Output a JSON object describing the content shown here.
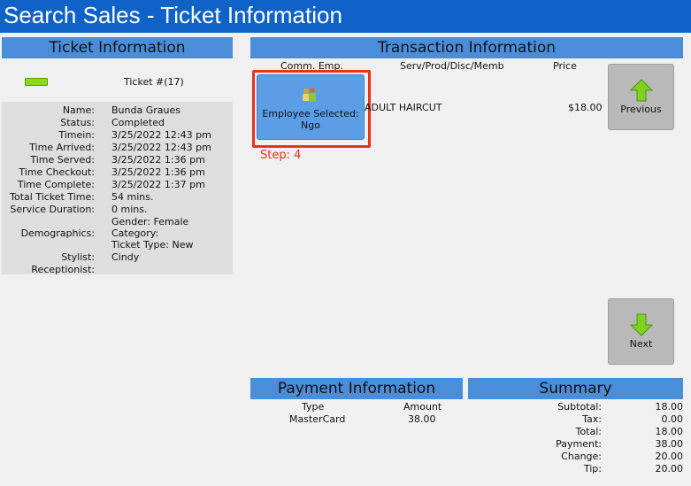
{
  "window": {
    "title": "Search Sales - Ticket Information"
  },
  "ticket_panel": {
    "header": "Ticket Information",
    "ticket_number": "Ticket #(17)",
    "fields": [
      {
        "label": "Name:",
        "value": "Bunda Graues"
      },
      {
        "label": "Status:",
        "value": "Completed"
      },
      {
        "label": "Timein:",
        "value": "3/25/2022 12:43 pm"
      },
      {
        "label": "Time Arrived:",
        "value": "3/25/2022 12:43 pm"
      },
      {
        "label": "Time Served:",
        "value": "3/25/2022 1:36 pm"
      },
      {
        "label": "Time Checkout:",
        "value": "3/25/2022 1:36 pm"
      },
      {
        "label": "Time Complete:",
        "value": "3/25/2022 1:37 pm"
      },
      {
        "label": "Total Ticket Time:",
        "value": "54 mins."
      },
      {
        "label": "Service Duration:",
        "value": "0 mins."
      }
    ],
    "demographics": {
      "label": "Demographics:",
      "lines": [
        "Gender: Female",
        "Category:",
        "Ticket Type: New"
      ]
    },
    "stylist": {
      "label": "Stylist:",
      "value": "Cindy"
    },
    "receptionist": {
      "label": "Receptionist:",
      "value": ""
    }
  },
  "transaction_panel": {
    "header": "Transaction Information",
    "columns": [
      "Comm. Emp.",
      "Serv/Prod/Disc/Memb",
      "Price"
    ],
    "rows": [
      {
        "service": "ADULT HAIRCUT",
        "price": "$18.00"
      }
    ],
    "employee_button": {
      "line1": "Employee Selected:",
      "line2": "Ngo"
    },
    "step_label": "Step: 4",
    "previous_label": "Previous",
    "next_label": "Next"
  },
  "payment_panel": {
    "header": "Payment Information",
    "columns": [
      "Type",
      "Amount"
    ],
    "rows": [
      {
        "type": "MasterCard",
        "amount": "38.00"
      }
    ]
  },
  "summary_panel": {
    "header": "Summary",
    "rows": [
      {
        "label": "Subtotal:",
        "value": "18.00"
      },
      {
        "label": "Tax:",
        "value": "0.00"
      },
      {
        "label": "Total:",
        "value": "18.00"
      },
      {
        "label": "Payment:",
        "value": "38.00"
      },
      {
        "label": "Change:",
        "value": "20.00"
      },
      {
        "label": "Tip:",
        "value": "20.00"
      }
    ]
  },
  "colors": {
    "title_bar": "#0f62c8",
    "panel_header": "#4a8ed9",
    "employee_button": "#5b9ee6",
    "highlight_outline": "#e8331a",
    "step_text": "#e8331a",
    "status_indicator": "#8fd61c"
  },
  "icons": {
    "status_indicator": "green-bar",
    "employee": "people-icon",
    "previous": "arrow-up-icon",
    "next": "arrow-down-icon"
  }
}
